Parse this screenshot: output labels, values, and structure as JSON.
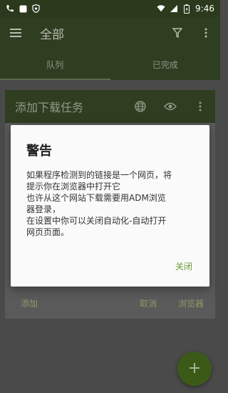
{
  "status_bar": {
    "time": "9:46",
    "icons": [
      "call-icon",
      "square-app-icon",
      "shield-icon",
      "wifi-icon",
      "signal-icon",
      "battery-icon"
    ]
  },
  "app_bar": {
    "title": "全部",
    "icons": [
      "menu-icon",
      "filter-icon",
      "more-vert-icon"
    ]
  },
  "tabs": [
    {
      "label": "队列",
      "active": true
    },
    {
      "label": "已完成",
      "active": false
    }
  ],
  "add_dialog": {
    "title": "添加下载任务",
    "icons": [
      "globe-icon",
      "eye-icon",
      "more-vert-icon"
    ],
    "buttons": {
      "add": "添加",
      "cancel": "取消",
      "browser": "浏览器"
    }
  },
  "warning": {
    "title": "警告",
    "lines": [
      "如果程序检测到的链接是一个网页，将",
      "提示你在浏览器中打开它",
      "也许从这个网站下载需要用ADM浏览",
      "器登录，",
      "在设置中你可以关闭自动化-自动打开",
      "网页页面。"
    ],
    "close_label": "关闭"
  },
  "fab": {
    "icon": "plus-icon"
  },
  "colors": {
    "toolbar": "#2f3d21",
    "accent": "#6b9a2f",
    "fab": "#3b5a18"
  }
}
